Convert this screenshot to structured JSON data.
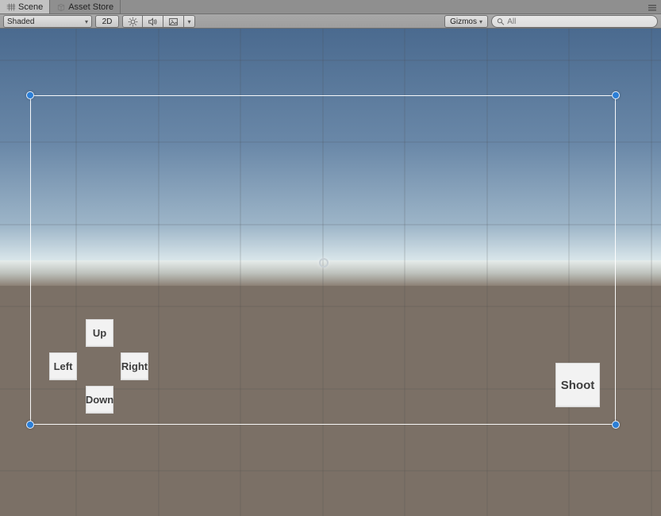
{
  "tabs": {
    "scene": "Scene",
    "assetstore": "Asset Store"
  },
  "toolbar": {
    "shading": "Shaded",
    "mode2d": "2D",
    "gizmos": "Gizmos"
  },
  "search": {
    "placeholder": "All"
  },
  "ui": {
    "up": "Up",
    "left": "Left",
    "right": "Right",
    "down": "Down",
    "shoot": "Shoot"
  }
}
